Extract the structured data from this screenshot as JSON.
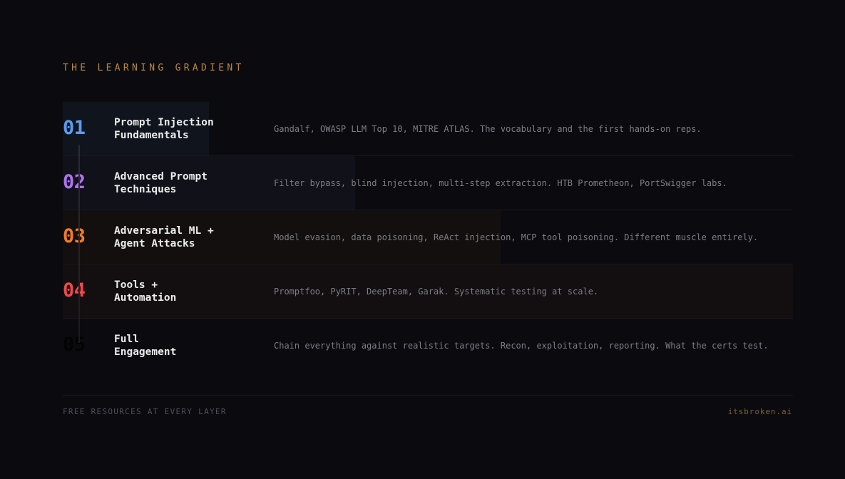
{
  "header": {
    "title": "THE LEARNING GRADIENT"
  },
  "layers": [
    {
      "number": "01",
      "title_line1": "Prompt Injection",
      "title_line2": "Fundamentals",
      "description": "Gandalf, OWASP LLM Top 10, MITRE ATLAS. The vocabulary and the first hands-on reps.",
      "number_color": "#5b9cf0",
      "fill_color": "#0f141d",
      "progress": 0.2
    },
    {
      "number": "02",
      "title_line1": "Advanced Prompt",
      "title_line2": "Techniques",
      "description": "Filter bypass, blind injection, multi-step extraction. HTB Prometheon, PortSwigger labs.",
      "number_color": "#b072f0",
      "fill_color": "#11111a",
      "progress": 0.4
    },
    {
      "number": "03",
      "title_line1": "Adversarial ML +",
      "title_line2": "Agent Attacks",
      "description": "Model evasion, data poisoning, ReAct injection, MCP tool poisoning. Different muscle entirely.",
      "number_color": "#f07a2a",
      "fill_color": "#130f0f",
      "progress": 0.6
    },
    {
      "number": "04",
      "title_line1": "Tools +",
      "title_line2": "Automation",
      "description": "Promptfoo, PyRIT, DeepTeam, Garak. Systematic testing at scale.",
      "number_color": "#ec4a4c",
      "fill_color": "#130e10",
      "progress": 1.0
    },
    {
      "number": "05",
      "title_line1": "Full",
      "title_line2": "Engagement",
      "description": "Chain everything against realistic targets. Recon, exploitation, reporting. What the certs test.",
      "number_color": "#030304",
      "fill_color": "#0b0b0f",
      "progress": 0.0
    }
  ],
  "footer": {
    "left": "FREE RESOURCES AT EVERY LAYER",
    "right": "itsbroken.ai"
  }
}
